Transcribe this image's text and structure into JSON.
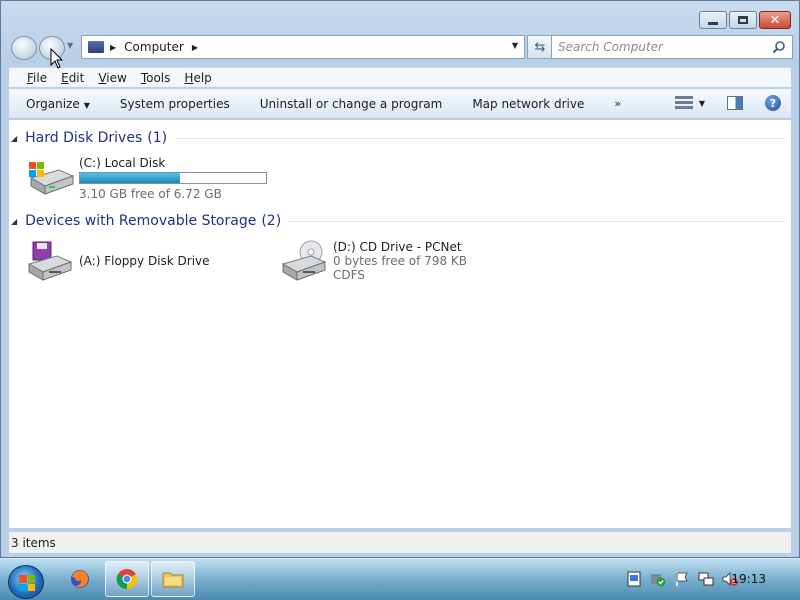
{
  "window": {
    "address_root": "Computer",
    "search_placeholder": "Search Computer"
  },
  "menu": [
    {
      "label": "File",
      "accel": "F",
      "rest": "ile"
    },
    {
      "label": "Edit",
      "accel": "E",
      "rest": "dit"
    },
    {
      "label": "View",
      "accel": "V",
      "rest": "iew"
    },
    {
      "label": "Tools",
      "accel": "T",
      "rest": "ools"
    },
    {
      "label": "Help",
      "accel": "H",
      "rest": "elp"
    }
  ],
  "toolbar": {
    "organize": "Organize",
    "system_properties": "System properties",
    "uninstall": "Uninstall or change a program",
    "map_drive": "Map network drive",
    "more": "»"
  },
  "groups": {
    "hdd": {
      "title": "Hard Disk Drives",
      "count": "(1)"
    },
    "removable": {
      "title": "Devices with Removable Storage",
      "count": "(2)"
    }
  },
  "drives": {
    "c": {
      "name": "(C:) Local Disk",
      "free": "3.10 GB free of 6.72 GB",
      "used_fraction": 0.54
    },
    "a": {
      "name": "(A:) Floppy Disk Drive"
    },
    "d": {
      "name": "(D:) CD Drive - PCNet",
      "free": "0 bytes free of 798 KB",
      "fs": "CDFS"
    }
  },
  "status": {
    "items": "3 items"
  },
  "taskbar": {
    "clock": "19:13"
  },
  "colors": {
    "accent": "#1e3287",
    "capacity_fill": "#1c8bb8"
  }
}
